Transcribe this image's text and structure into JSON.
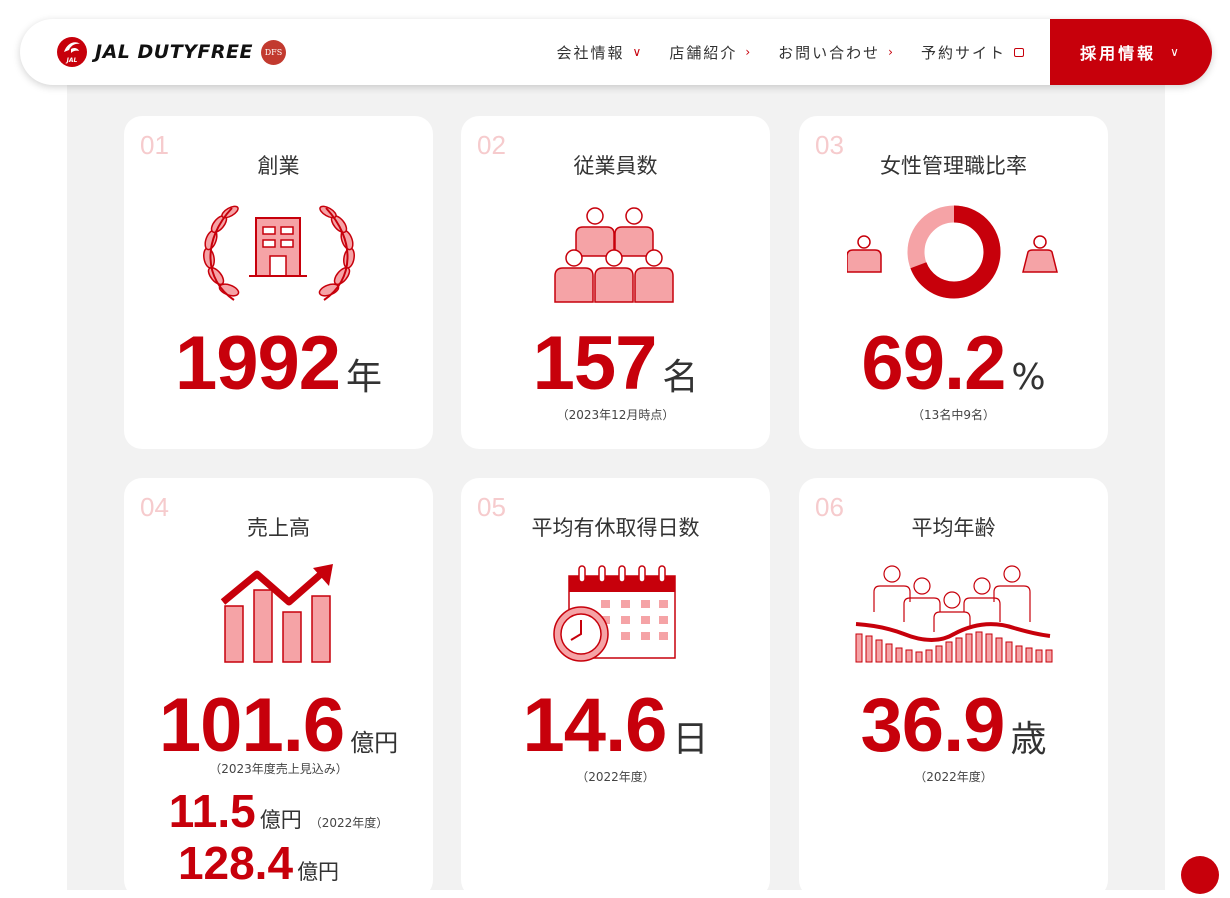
{
  "header": {
    "logo_text": "JAL DUTYFREE",
    "logo_mark_text": "JAL",
    "logo_badge": "DFS",
    "nav": [
      {
        "label": "会社情報",
        "icon": "chevron-down-icon",
        "glyph": "∨"
      },
      {
        "label": "店舗紹介",
        "icon": "chevron-right-icon",
        "glyph": "›"
      },
      {
        "label": "お問い合わせ",
        "icon": "chevron-right-icon",
        "glyph": "›"
      },
      {
        "label": "予約サイト",
        "icon": "external-link-icon",
        "glyph": ""
      }
    ],
    "recruit_label": "採用情報",
    "recruit_glyph": "∨"
  },
  "colors": {
    "accent": "#c7000b",
    "light_accent": "#f5a3a6",
    "number_faint": "#f6cbcd",
    "panel_bg": "#f2f2f2"
  },
  "cards": [
    {
      "num": "01",
      "title": "創業",
      "value": "1992",
      "unit": "年",
      "note": "",
      "icon": "building-laurel-icon"
    },
    {
      "num": "02",
      "title": "従業員数",
      "value": "157",
      "unit": "名",
      "note": "（2023年12月時点）",
      "icon": "people-group-icon"
    },
    {
      "num": "03",
      "title": "女性管理職比率",
      "value": "69.2",
      "unit": "%",
      "note": "（13名中9名）",
      "icon": "donut-ratio-icon",
      "ratio": 0.692
    },
    {
      "num": "04",
      "title": "売上高",
      "value": "101.6",
      "unit": "億円",
      "note": "（2023年度売上見込み）",
      "icon": "growth-chart-icon",
      "extra": [
        {
          "value": "11.5",
          "unit": "億円",
          "note": "（2022年度）"
        },
        {
          "value": "128.4",
          "unit": "億円",
          "note": ""
        }
      ]
    },
    {
      "num": "05",
      "title": "平均有休取得日数",
      "value": "14.6",
      "unit": "日",
      "note": "（2022年度）",
      "icon": "calendar-clock-icon"
    },
    {
      "num": "06",
      "title": "平均年齢",
      "value": "36.9",
      "unit": "歳",
      "note": "（2022年度）",
      "icon": "people-age-bars-icon"
    }
  ]
}
